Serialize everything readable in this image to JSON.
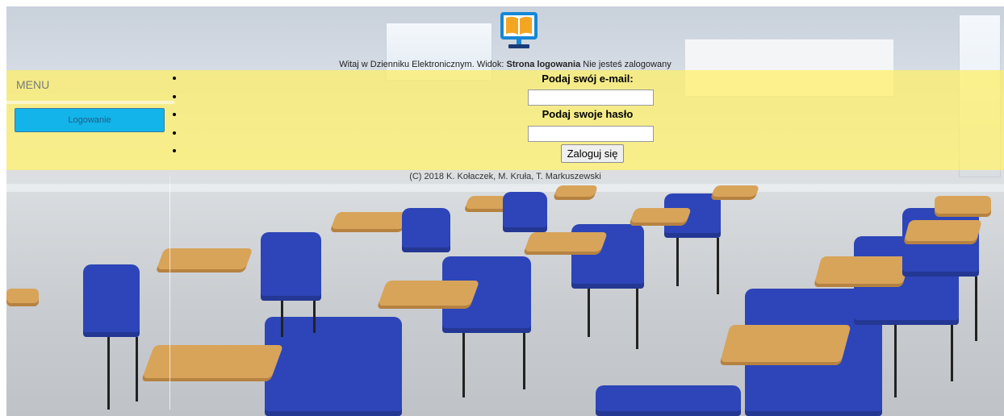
{
  "header": {
    "logo_icon": "open-book-monitor-icon",
    "welcome_prefix": "Witaj w Dzienniku Elektronicznym. Widok:",
    "view_name": "Strona logowania",
    "status": "Nie jesteś zalogowany"
  },
  "menu": {
    "title": "MENU",
    "items": [
      {
        "label": "Logowanie"
      }
    ]
  },
  "login": {
    "email_label": "Podaj swój e-mail:",
    "email_value": "",
    "password_label": "Podaj swoje hasło",
    "password_value": "",
    "submit_label": "Zaloguj się"
  },
  "footer": {
    "copyright": "(C) 2018 K. Kołaczek, M. Kruła, T. Markuszewski"
  },
  "colors": {
    "main_band": "#f7ea6a",
    "menu_button": "#12b4ea",
    "logo_screen": "#1787d6",
    "book": "#f4a623"
  }
}
